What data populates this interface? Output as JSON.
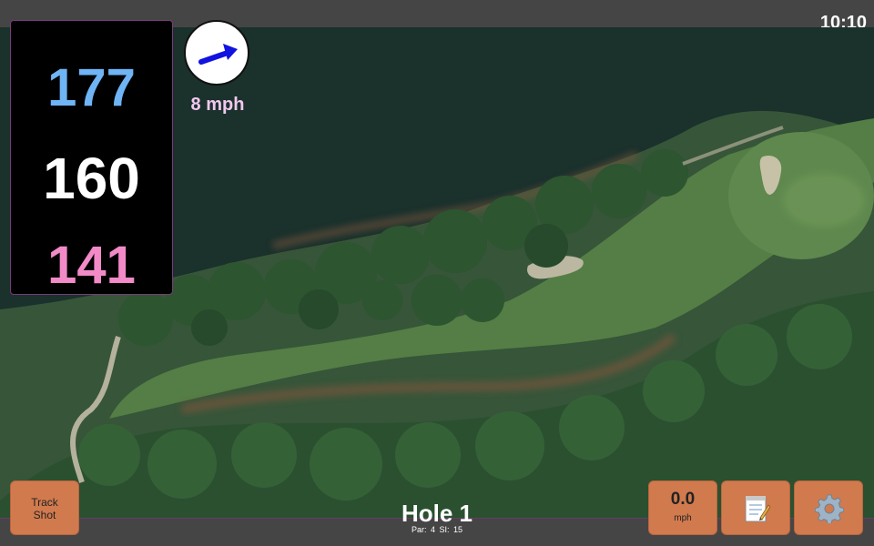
{
  "status_bar": {
    "time": "10:10"
  },
  "yardages": {
    "back": "177",
    "middle": "160",
    "front": "141",
    "colors": {
      "back": "#6fb4f5",
      "middle": "#ffffff",
      "front": "#f28ac8"
    }
  },
  "wind": {
    "speed": "8 mph",
    "icon": "wind-direction-arrow-icon",
    "arrow_color": "#1212e0"
  },
  "buttons": {
    "track_shot": "Track\nShot",
    "speed_value": "0.0",
    "speed_unit": "mph",
    "notes_icon": "notepad-icon",
    "settings_icon": "gear-icon"
  },
  "hole": {
    "title": "Hole 1",
    "par": "Par: 4",
    "stroke_index": "SI: 15"
  },
  "colors": {
    "button": "#d17a4e",
    "panel_border": "#7b3a7b"
  }
}
